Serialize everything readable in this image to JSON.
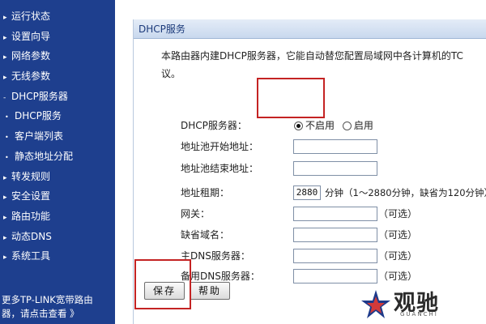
{
  "sidebar": {
    "items": [
      {
        "label": "运行状态",
        "level": 1
      },
      {
        "label": "设置向导",
        "level": 1
      },
      {
        "label": "网络参数",
        "level": 1
      },
      {
        "label": "无线参数",
        "level": 1
      },
      {
        "label": "DHCP服务器",
        "level": 1,
        "expanded": true
      },
      {
        "label": "DHCP服务",
        "level": 2
      },
      {
        "label": "客户端列表",
        "level": 2
      },
      {
        "label": "静态地址分配",
        "level": 2
      },
      {
        "label": "转发规则",
        "level": 1
      },
      {
        "label": "安全设置",
        "level": 1
      },
      {
        "label": "路由功能",
        "level": 1
      },
      {
        "label": "动态DNS",
        "level": 1
      },
      {
        "label": "系统工具",
        "level": 1
      }
    ],
    "footer_line1": "更多TP-LINK宽带路由",
    "footer_line2": "器，请点击查看 》"
  },
  "panel": {
    "title": "DHCP服务",
    "description_line1": "本路由器内建DHCP服务器，它能自动替您配置局域网中各计算机的TC",
    "description_line2": "议。"
  },
  "form": {
    "dhcp_server_label": "DHCP服务器：",
    "radio_disabled_label": "不启用",
    "radio_enabled_label": "启用",
    "selected": "不启用",
    "pool_start_label": "地址池开始地址：",
    "pool_start_value": "",
    "pool_end_label": "地址池结束地址：",
    "pool_end_value": "",
    "lease_label": "地址租期：",
    "lease_value": "2880",
    "lease_hint": "分钟（1～2880分钟，缺省为120分钟）",
    "gateway_label": "网关：",
    "gateway_value": "",
    "domain_label": "缺省域名：",
    "domain_value": "",
    "primary_dns_label": "主DNS服务器：",
    "primary_dns_value": "",
    "secondary_dns_label": "备用DNS服务器：",
    "secondary_dns_value": "",
    "optional_text": "（可选）"
  },
  "buttons": {
    "save": "保存",
    "help": "帮助"
  },
  "watermark": {
    "brand": "观驰",
    "sub": "GUANCHI"
  },
  "colors": {
    "sidebar_bg": "#1e3f8e",
    "annotation_red": "#c42323",
    "panel_title_text": "#1b3a7a"
  }
}
